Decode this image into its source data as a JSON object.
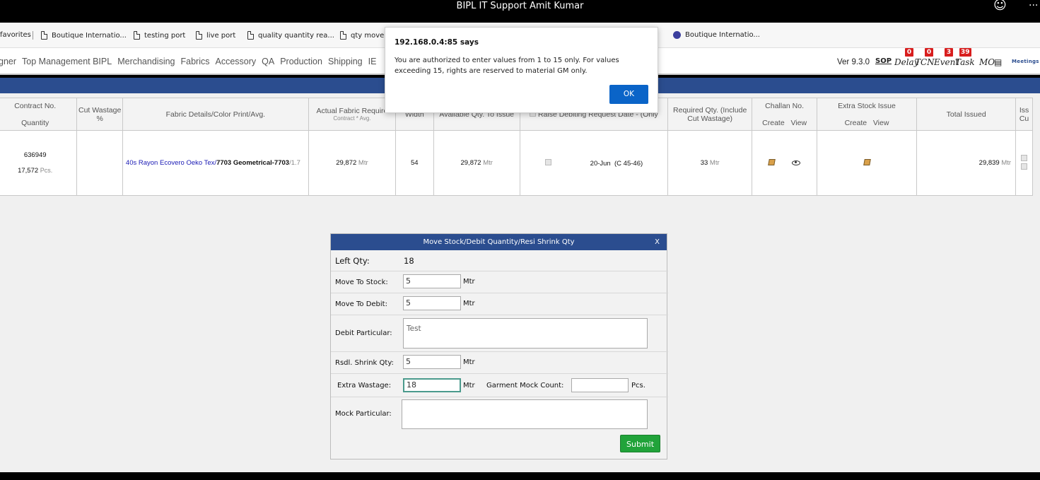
{
  "window": {
    "title": "BIPL IT Support Amit Kumar",
    "icons": [
      "smiley-icon",
      "more-icon"
    ]
  },
  "favorites": {
    "first": "favorites",
    "items": [
      "Boutique Internatio...",
      "testing port",
      "live port",
      "quality quantity rea...",
      "qty move",
      "Boutique Internatio..."
    ]
  },
  "nav": {
    "items": [
      "gner",
      "Top Management BIPL",
      "Merchandising",
      "Fabrics",
      "Accessory",
      "QA",
      "Production",
      "Shipping",
      "IE"
    ],
    "version": "Ver 9.3.0",
    "tools": [
      {
        "label": "SOP",
        "badge": ""
      },
      {
        "label": "Delay",
        "badge": "0"
      },
      {
        "label": "TCN",
        "badge": "0"
      },
      {
        "label": "Event",
        "badge": "3"
      },
      {
        "label": "Task",
        "badge": "39"
      },
      {
        "label": "MO",
        "badge": ""
      },
      {
        "label": "Meetings",
        "badge": ""
      }
    ],
    "badge_color": "#d81e1e"
  },
  "table": {
    "headers": {
      "contract": "Contract No.",
      "quantity": "Quantity",
      "cut_wastage": "Cut Wastage %",
      "fabric_details": "Fabric Details/Color Print/Avg.",
      "actual_fabric": "Actual Fabric Require",
      "actual_fabric_sub": "Contract * Avg.",
      "width": "Width",
      "available": "Available Qty. To Issue",
      "raise_debit": "Raise Debiting Request Date - (Only",
      "required": "Required Qty. (Include Cut Wastage)",
      "challan": "Challan No.",
      "challan_create": "Create",
      "challan_view": "View",
      "extra_stock": "Extra Stock Issue",
      "extra_create": "Create",
      "extra_view": "View",
      "total_issued": "Total Issued",
      "iss": "Iss",
      "cu": "Cu"
    },
    "row": {
      "contract_no": "636949",
      "quantity": "17,572",
      "quantity_unit": "Pcs.",
      "fabric_name": "40s Rayon Ecovero Oeko Tex/",
      "fabric_color": "7703 Geometrical-7703",
      "fabric_avg": "/1.7",
      "actual_fabric": "29,872",
      "actual_unit": "Mtr",
      "width": "54",
      "available": "29,872",
      "available_unit": "Mtr",
      "date": "20-Jun",
      "date_note": "(C 45-46)",
      "required": "33",
      "required_unit": "Mtr",
      "total_issued": "29,839",
      "total_unit": "Mtr"
    }
  },
  "panel": {
    "title": "Move Stock/Debit Quantity/Resi Shrink Qty",
    "close": "X",
    "left_qty_label": "Left Qty:",
    "left_qty_value": "18",
    "move_stock_label": "Move To Stock:",
    "move_stock_value": "5",
    "move_debit_label": "Move To Debit:",
    "move_debit_value": "5",
    "debit_particular_label": "Debit Particular:",
    "debit_particular_value": "Test",
    "rsdl_label": "Rsdl. Shrink Qty:",
    "rsdl_value": "5",
    "extra_wastage_label": "Extra Wastage:",
    "extra_wastage_value": "18",
    "garment_mock_label": "Garment Mock Count:",
    "garment_mock_value": "",
    "pcs_unit": "Pcs.",
    "mtr_unit": "Mtr",
    "mock_particular_label": "Mock Particular:",
    "mock_particular_value": "",
    "submit_label": "Submit"
  },
  "alert": {
    "title": "192.168.0.4:85 says",
    "message": "You are authorized to enter values from 1 to 15 only. For values exceeding 15, rights are reserved to material GM only.",
    "ok_label": "OK",
    "ok_color": "#0a64c8"
  },
  "colors": {
    "header_blue": "#2b4d8f",
    "submit_green": "#21a33a"
  }
}
